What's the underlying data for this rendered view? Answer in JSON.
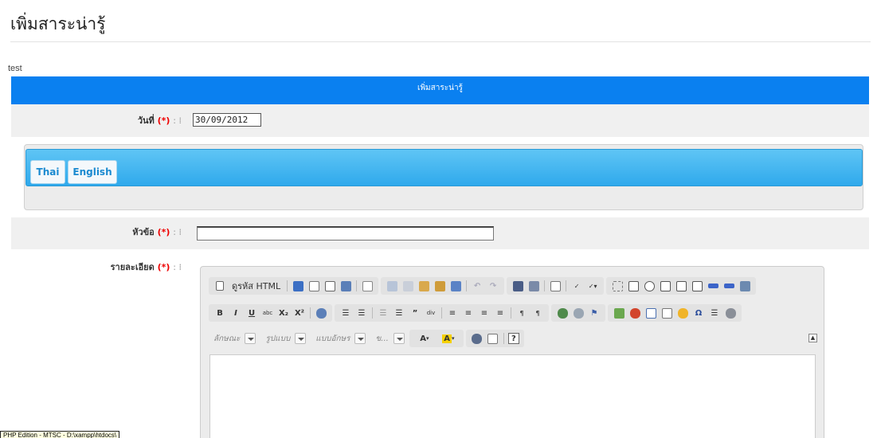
{
  "page": {
    "title": "เพิ่มสาระน่ารู้",
    "debug_text": "test"
  },
  "form": {
    "header": "เพิ่มสาระน่ารู้",
    "required_mark": "(*)",
    "label_separator": ":",
    "date": {
      "label": "วันที่",
      "value": "30/09/2012"
    },
    "language_tabs": [
      {
        "label": "Thai"
      },
      {
        "label": "English"
      }
    ],
    "topic": {
      "label": "หัวข้อ",
      "value": ""
    },
    "detail": {
      "label": "รายละเอียด"
    }
  },
  "editor": {
    "source_button": "ดูรหัส HTML",
    "combos": [
      {
        "label": "ลักษณะ"
      },
      {
        "label": "รูปแบบ"
      },
      {
        "label": "แบบอักษร"
      },
      {
        "label": "ข..."
      }
    ],
    "format": {
      "bold": "B",
      "italic": "I",
      "underline": "U",
      "strike": "abc",
      "subscript": "X₂",
      "superscript": "X²"
    },
    "collapse_symbol": "▲",
    "help_symbol": "?"
  },
  "status_tooltip": "PHP Edition - MTSC - D:\\xampp\\htdocs\\",
  "colors": {
    "header_blue": "#0a80f0",
    "tab_bar_blue": "#2fa9ec",
    "required_red": "#e00000",
    "row_gray": "#f0f0f0"
  }
}
